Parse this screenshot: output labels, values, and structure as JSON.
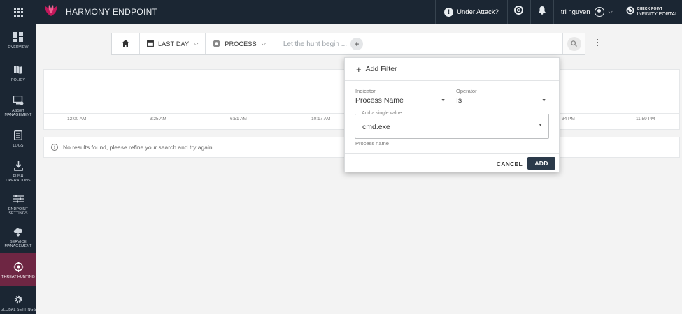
{
  "app": {
    "title": "HARMONY ENDPOINT"
  },
  "topbar": {
    "under_attack": "Under Attack?",
    "user_name": "tri nguyen",
    "portal_small": "CHECK POINT",
    "portal_big": "INFINITY PORTAL"
  },
  "sidebar": {
    "items": [
      {
        "label": "OVERVIEW",
        "icon": "overview-icon"
      },
      {
        "label": "POLICY",
        "icon": "policy-icon"
      },
      {
        "label": "ASSET MANAGEMENT",
        "icon": "asset-management-icon"
      },
      {
        "label": "LOGS",
        "icon": "logs-icon"
      },
      {
        "label": "PUSH OPERATIONS",
        "icon": "push-operations-icon"
      },
      {
        "label": "ENDPOINT SETTINGS",
        "icon": "endpoint-settings-icon"
      },
      {
        "label": "SERVICE MANAGEMENT",
        "icon": "service-management-icon"
      },
      {
        "label": "THREAT HUNTING",
        "icon": "threat-hunting-icon",
        "active": true
      },
      {
        "label": "GLOBAL SETTINGS",
        "icon": "global-settings-icon"
      }
    ]
  },
  "search": {
    "time_range": "LAST DAY",
    "entity": "PROCESS",
    "placeholder": "Let the hunt begin ..."
  },
  "timeline": {
    "ticks": [
      "12:00 AM",
      "3:25 AM",
      "6:51 AM",
      "10:17 AM",
      "34 PM",
      "11:59 PM"
    ]
  },
  "results": {
    "message": "No results found, please refine your search and try again..."
  },
  "add_filter": {
    "title": "Add Filter",
    "indicator_label": "Indicator",
    "indicator_value": "Process Name",
    "operator_label": "Operator",
    "operator_value": "Is",
    "value_legend": "Add a single value...",
    "value": "cmd.exe",
    "helper": "Process name",
    "cancel_label": "CANCEL",
    "add_label": "ADD"
  },
  "colors": {
    "nav_bg": "#1b2633",
    "active_item": "#6e2643",
    "brand_accent": "#c2185b",
    "primary_button": "#2b3a4a"
  }
}
